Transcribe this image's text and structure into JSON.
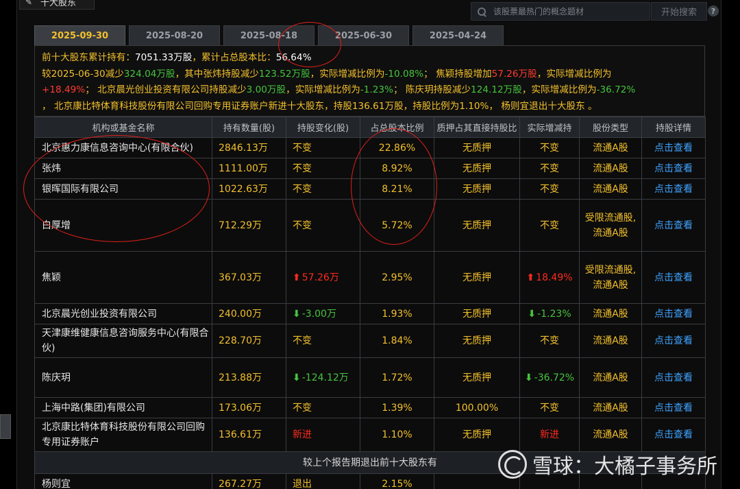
{
  "header": {
    "title": "十大股东"
  },
  "search": {
    "placeholder": "该股票最热门的概念题材",
    "button_label": "开始搜索"
  },
  "tabs": [
    {
      "label": "2025-09-30",
      "active": true
    },
    {
      "label": "2025-08-20",
      "active": false
    },
    {
      "label": "2025-08-18",
      "active": false
    },
    {
      "label": "2025-06-30",
      "active": false
    },
    {
      "label": "2025-04-24",
      "active": false
    }
  ],
  "summary": {
    "p1": "前十大股东累计持有：",
    "total_hold": "7051.33万股",
    "p2": "，累计占总股本比：",
    "total_ratio": "56.64%",
    "p3": "较2025-06-30减少",
    "decrease": "324.04万股",
    "p4": "，其中张炜持股减少",
    "zw_decrease": "123.52万股",
    "p5": "，实际增减比例为",
    "zw_ratio": "-10.08%",
    "p6": "；  焦颖持股增加",
    "jy_increase": "57.26万股",
    "p7": "，实际增减比例为",
    "jy_ratio": "+18.49%",
    "p8": "；  北京晨光创业投资有限公司持股减少",
    "bj_decrease": "3.00万股",
    "p9": "，实际增减比例为",
    "bj_ratio": "-1.23%",
    "p10": "；  陈庆玥持股减少",
    "cqy_decrease": "124.12万股",
    "p11": "，实际增减比例为",
    "cqy_ratio": "-36.72%",
    "p12": "，  北京康比特体育科技股份有限公司回购专用证券账户新进十大股东，持股136.61万股，持股比例为1.10%，  杨则宜退出十大股东 。"
  },
  "table": {
    "headers": [
      "机构或基金名称",
      "持有数量(股)",
      "持股变化(股)",
      "占总股本比例",
      "质押占其直接持股比",
      "实际增减持",
      "股份类型",
      "持股详情"
    ],
    "rows": [
      {
        "name": "北京惠力康信息咨询中心(有限合伙)",
        "qty": "2846.13万",
        "change": "不变",
        "change_dir": "",
        "ratio": "22.86%",
        "pledge": "无质押",
        "actual": "不变",
        "actual_dir": "",
        "type": "流通A股",
        "detail": "点击查看"
      },
      {
        "name": "张炜",
        "qty": "1111.00万",
        "change": "不变",
        "change_dir": "",
        "ratio": "8.92%",
        "pledge": "无质押",
        "actual": "不变",
        "actual_dir": "",
        "type": "流通A股",
        "detail": "点击查看"
      },
      {
        "name": "银晖国际有限公司",
        "qty": "1022.63万",
        "change": "不变",
        "change_dir": "",
        "ratio": "8.21%",
        "pledge": "无质押",
        "actual": "不变",
        "actual_dir": "",
        "type": "流通A股",
        "detail": "点击查看"
      },
      {
        "name": "白厚增",
        "qty": "712.29万",
        "change": "不变",
        "change_dir": "",
        "ratio": "5.72%",
        "pledge": "无质押",
        "actual": "不变",
        "actual_dir": "",
        "type": "受限流通股,流通A股",
        "detail": "点击查看"
      },
      {
        "name": "焦颖",
        "qty": "367.03万",
        "change": "57.26万",
        "change_dir": "up",
        "ratio": "2.95%",
        "pledge": "无质押",
        "actual": "18.49%",
        "actual_dir": "up",
        "type": "受限流通股,流通A股",
        "detail": "点击查看"
      },
      {
        "name": "北京晨光创业投资有限公司",
        "qty": "240.00万",
        "change": "-3.00万",
        "change_dir": "down",
        "ratio": "1.93%",
        "pledge": "无质押",
        "actual": "-1.23%",
        "actual_dir": "down",
        "type": "流通A股",
        "detail": "点击查看"
      },
      {
        "name": "天津康维健康信息咨询服务中心(有限合伙)",
        "qty": "228.70万",
        "change": "不变",
        "change_dir": "",
        "ratio": "1.84%",
        "pledge": "无质押",
        "actual": "不变",
        "actual_dir": "",
        "type": "流通A股",
        "detail": "点击查看"
      },
      {
        "name": "陈庆玥",
        "qty": "213.88万",
        "change": "-124.12万",
        "change_dir": "down",
        "ratio": "1.72%",
        "pledge": "无质押",
        "actual": "-36.72%",
        "actual_dir": "down",
        "type": "流通A股",
        "detail": "点击查看"
      },
      {
        "name": "上海中路(集团)有限公司",
        "qty": "173.06万",
        "change": "不变",
        "change_dir": "",
        "ratio": "1.39%",
        "pledge": "100.00%",
        "actual": "不变",
        "actual_dir": "",
        "type": "流通A股",
        "detail": "点击查看"
      },
      {
        "name": "北京康比特体育科技股份有限公司回购专用证券账户",
        "qty": "136.61万",
        "change": "新进",
        "change_dir": "new",
        "ratio": "1.10%",
        "pledge": "无质押",
        "actual": "新进",
        "actual_dir": "new",
        "type": "流通A股",
        "detail": "点击查看"
      }
    ],
    "exit_section_title": "较上个报告期退出前十大股东有",
    "exit_rows": [
      {
        "name": "杨则宜",
        "qty": "267.27万",
        "change": "退出",
        "ratio": "2.15%"
      }
    ]
  },
  "watermark": {
    "text": "雪球：大橘子事务所"
  }
}
